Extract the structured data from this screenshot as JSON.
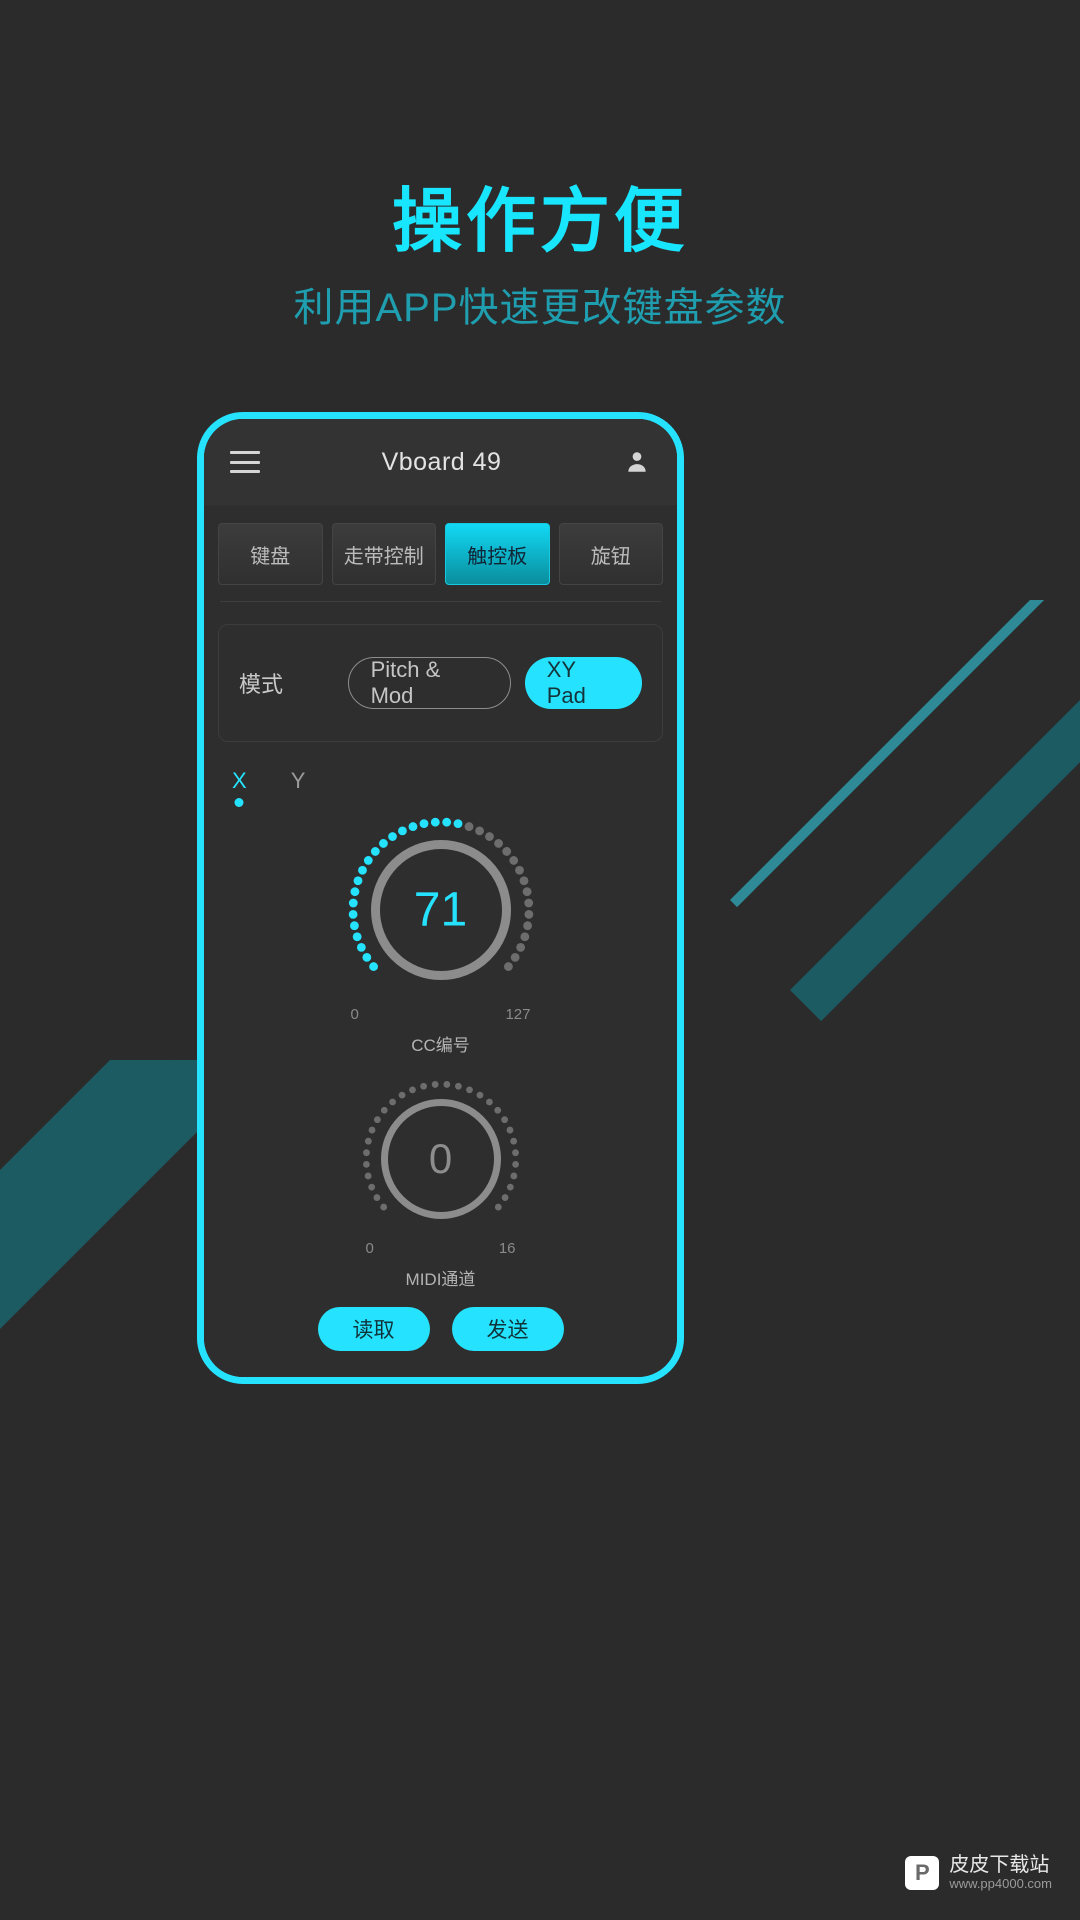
{
  "promo": {
    "headline": "操作方便",
    "subhead": "利用APP快速更改键盘参数",
    "headline_color": "#18e6ff",
    "subhead_color": "#1f9eb0"
  },
  "app": {
    "title": "Vboard 49",
    "menu_icon": "hamburger-icon",
    "account_icon": "person-icon",
    "tabs": [
      {
        "label": "键盘",
        "active": false
      },
      {
        "label": "走带控制",
        "active": false
      },
      {
        "label": "触控板",
        "active": true
      },
      {
        "label": "旋钮",
        "active": false
      }
    ],
    "mode": {
      "label": "模式",
      "options": [
        {
          "label": "Pitch & Mod",
          "selected": false
        },
        {
          "label": "XY Pad",
          "selected": true
        }
      ]
    },
    "axis_tabs": [
      {
        "label": "X",
        "active": true
      },
      {
        "label": "Y",
        "active": false
      }
    ],
    "knobs": [
      {
        "value": "71",
        "min": "0",
        "max": "127",
        "caption": "CC编号",
        "fill_ratio": 0.56,
        "ticks": 36
      },
      {
        "value": "0",
        "min": "0",
        "max": "16",
        "caption": "MIDI通道",
        "fill_ratio": 0,
        "ticks": 30
      }
    ],
    "actions": [
      {
        "label": "读取"
      },
      {
        "label": "发送"
      }
    ],
    "accent_color": "#25e3ff"
  },
  "watermark": {
    "logo": "P",
    "site_name": "皮皮下载站",
    "url": "www.pp4000.com"
  }
}
